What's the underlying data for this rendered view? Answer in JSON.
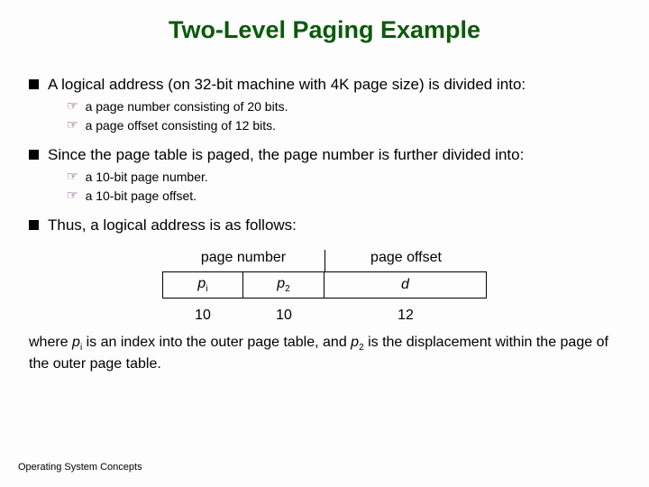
{
  "title": "Two-Level Paging Example",
  "bullets": {
    "b1": "A logical address (on 32-bit machine with 4K page size) is divided into:",
    "b1a": "a page number consisting of 20 bits.",
    "b1b": "a page offset consisting of 12 bits.",
    "b2": "Since the page table is paged, the page number is further divided into:",
    "b2a": "a 10-bit page number.",
    "b2b": "a 10-bit page offset.",
    "b3": "Thus, a logical address is as follows:"
  },
  "diagram": {
    "header_left": "page number",
    "header_right": "page offset",
    "cell_p": "p",
    "cell_p_sub1": "i",
    "cell_p_sub2": "2",
    "cell_d": "d",
    "bits_a": "10",
    "bits_b": "10",
    "bits_c": "12"
  },
  "closing": {
    "pre": "where ",
    "p1": "p",
    "p1sub": "i",
    "mid1": " is an index into the outer page table, and ",
    "p2": "p",
    "p2sub": "2",
    "mid2": " is the displacement within the page of the outer page table."
  },
  "footer": "Operating System Concepts"
}
